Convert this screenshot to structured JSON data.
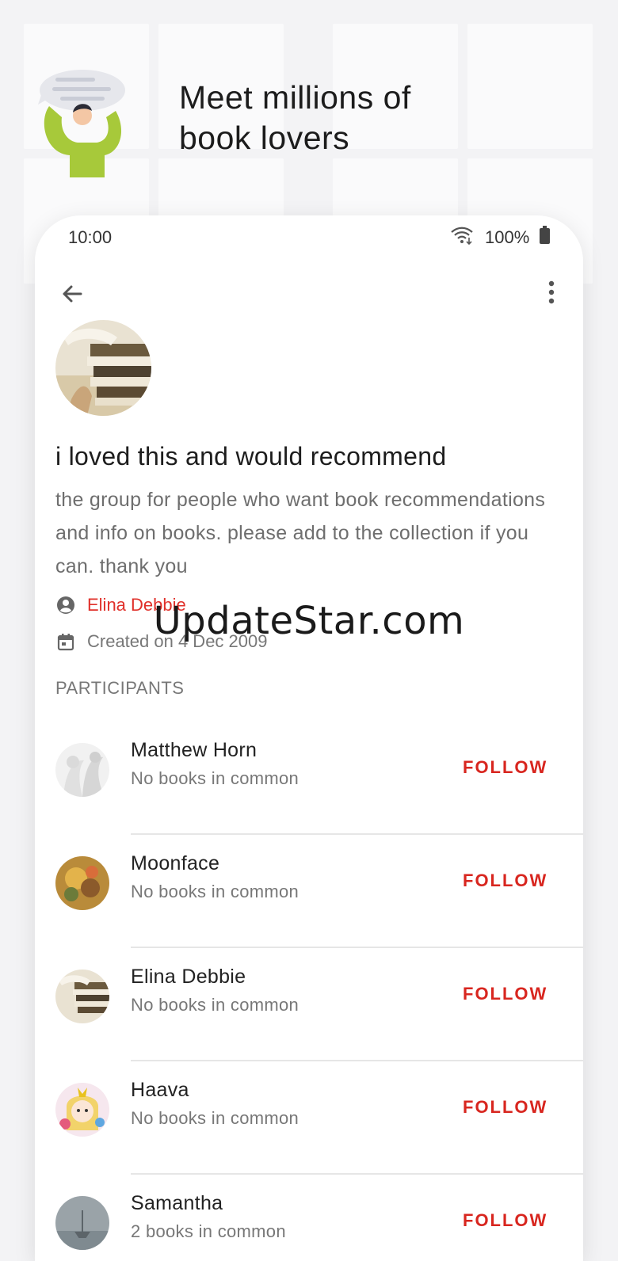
{
  "promo": {
    "title_line1": "Meet millions of",
    "title_line2": "book lovers"
  },
  "status_bar": {
    "time": "10:00",
    "battery": "100%"
  },
  "group": {
    "title": "i loved this and would recommend",
    "description": "the group for people who want book recommendations and info on books. please add to the collection if you can. thank you",
    "owner": "Elina Debbie",
    "created": "Created on 4 Dec 2009"
  },
  "participants": {
    "label": "PARTICIPANTS",
    "items": [
      {
        "name": "Matthew Horn",
        "subtitle": "No books in common",
        "action": "FOLLOW"
      },
      {
        "name": "Moonface",
        "subtitle": "No books in common",
        "action": "FOLLOW"
      },
      {
        "name": "Elina Debbie",
        "subtitle": "No books in common",
        "action": "FOLLOW"
      },
      {
        "name": "Haava",
        "subtitle": "No books in common",
        "action": "FOLLOW"
      },
      {
        "name": "Samantha",
        "subtitle": "2 books in common",
        "action": "FOLLOW"
      }
    ]
  },
  "watermark": "UpdateStar.com",
  "colors": {
    "accent": "#d8261f",
    "owner_link": "#e0302a",
    "illustration_green": "#a7c93a"
  },
  "icons": [
    "wifi-icon",
    "battery-icon",
    "back-arrow-icon",
    "more-vert-icon",
    "account-circle-icon",
    "calendar-icon"
  ]
}
